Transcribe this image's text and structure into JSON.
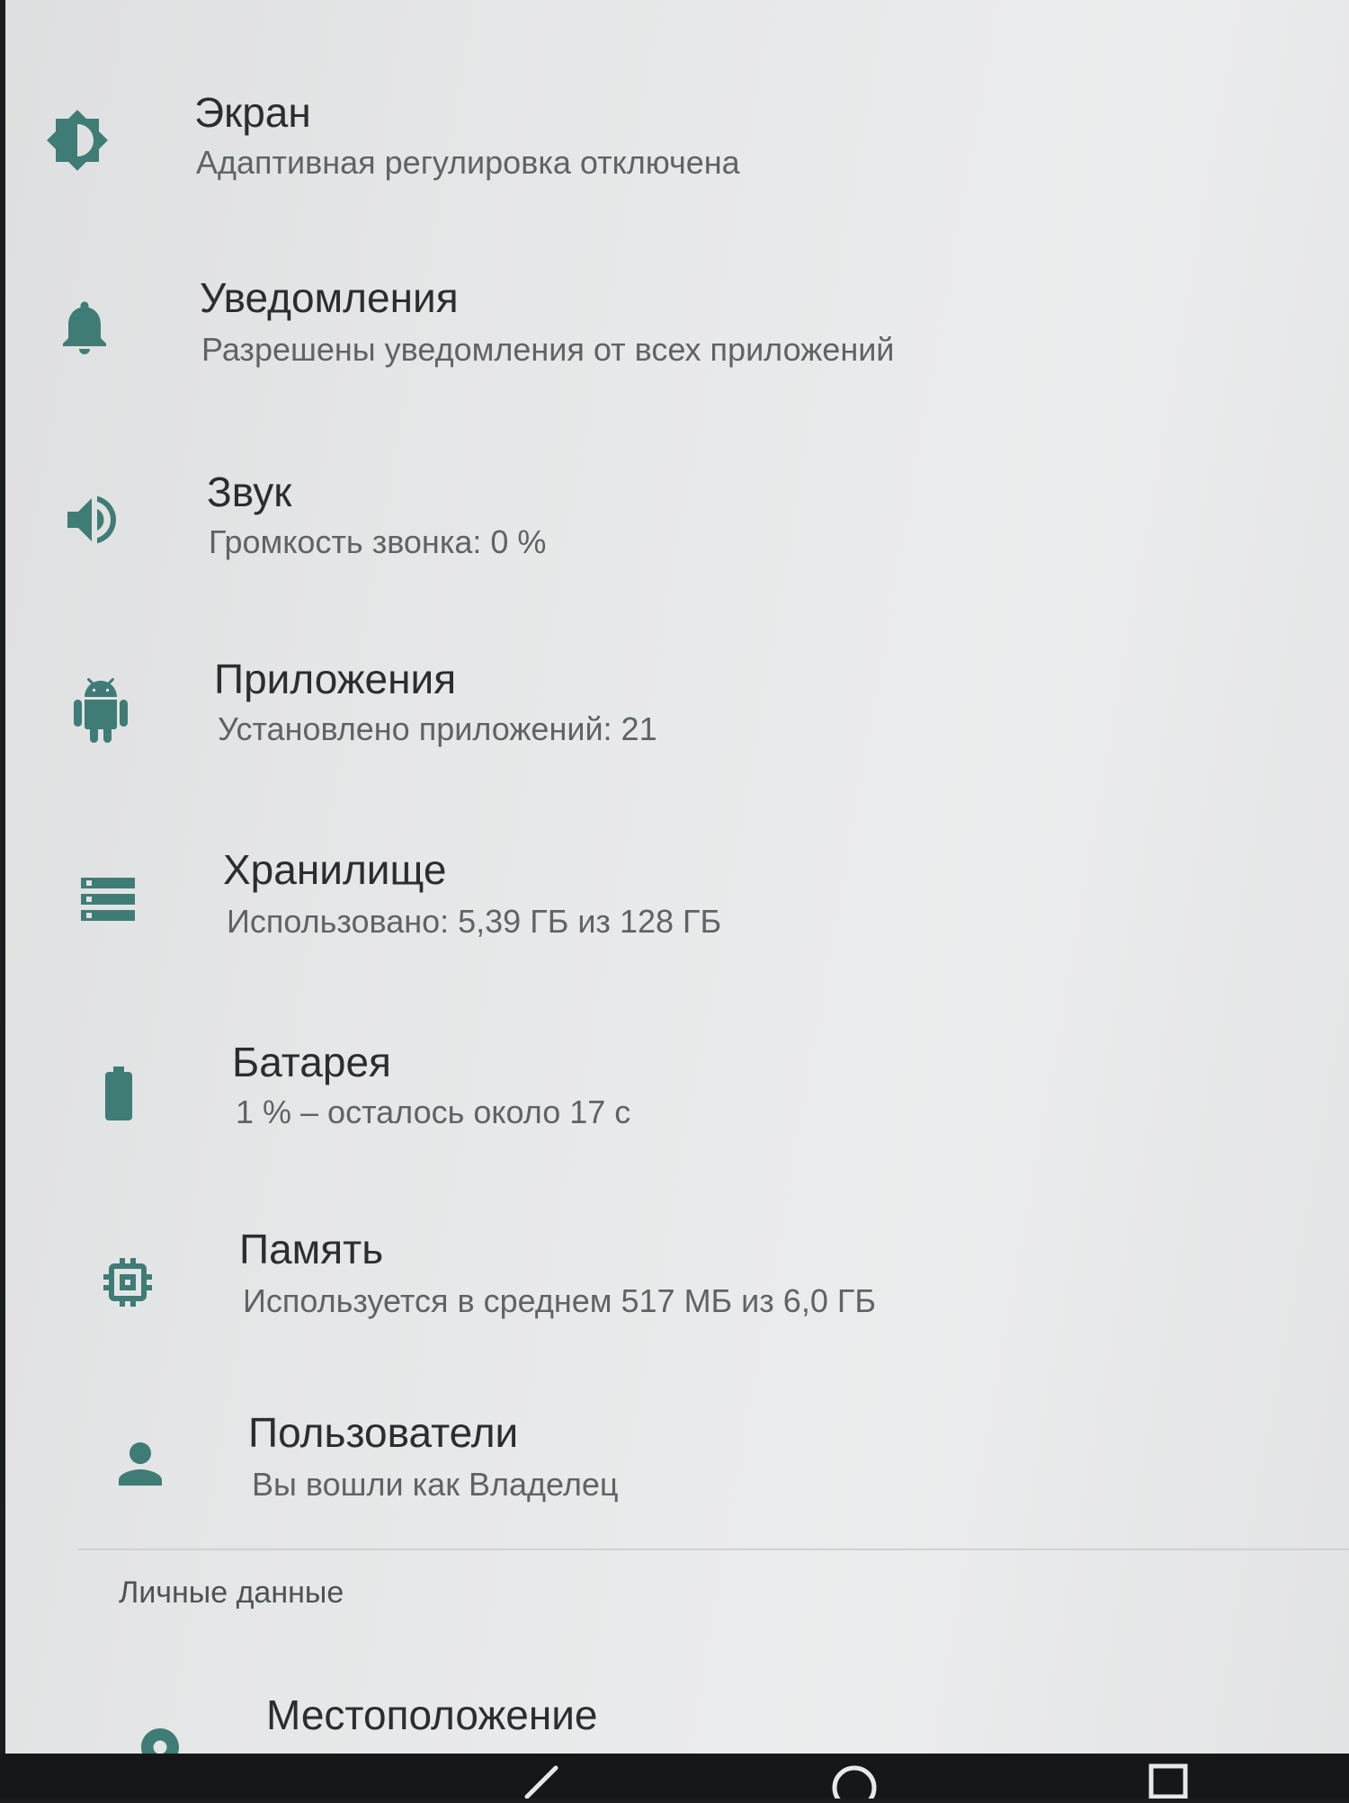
{
  "colors": {
    "icon_teal": "#3f7c76",
    "title": "#2b2d2f",
    "summary": "#5f6366"
  },
  "settings": [
    {
      "icon": "brightness-icon",
      "title": "Экран",
      "summary": "Адаптивная регулировка отключена"
    },
    {
      "icon": "bell-icon",
      "title": "Уведомления",
      "summary": "Разрешены уведомления от всех приложений"
    },
    {
      "icon": "volume-icon",
      "title": "Звук",
      "summary": "Громкость звонка: 0 %"
    },
    {
      "icon": "android-icon",
      "title": "Приложения",
      "summary": "Установлено приложений: 21"
    },
    {
      "icon": "storage-icon",
      "title": "Хранилище",
      "summary": "Использовано: 5,39 ГБ из 128 ГБ"
    },
    {
      "icon": "battery-icon",
      "title": "Батарея",
      "summary": "1 % – осталось около 17 с"
    },
    {
      "icon": "memory-chip-icon",
      "title": "Память",
      "summary": "Используется в среднем 517 МБ из 6,0 ГБ"
    },
    {
      "icon": "person-icon",
      "title": "Пользователи",
      "summary": "Вы вошли как Владелец"
    }
  ],
  "personal": {
    "category_label": "Личные данные",
    "location": {
      "icon": "location-pin-icon",
      "title": "Местоположение"
    }
  },
  "navbar": {
    "back": "back-icon",
    "home": "home-icon",
    "recents": "recents-icon"
  }
}
